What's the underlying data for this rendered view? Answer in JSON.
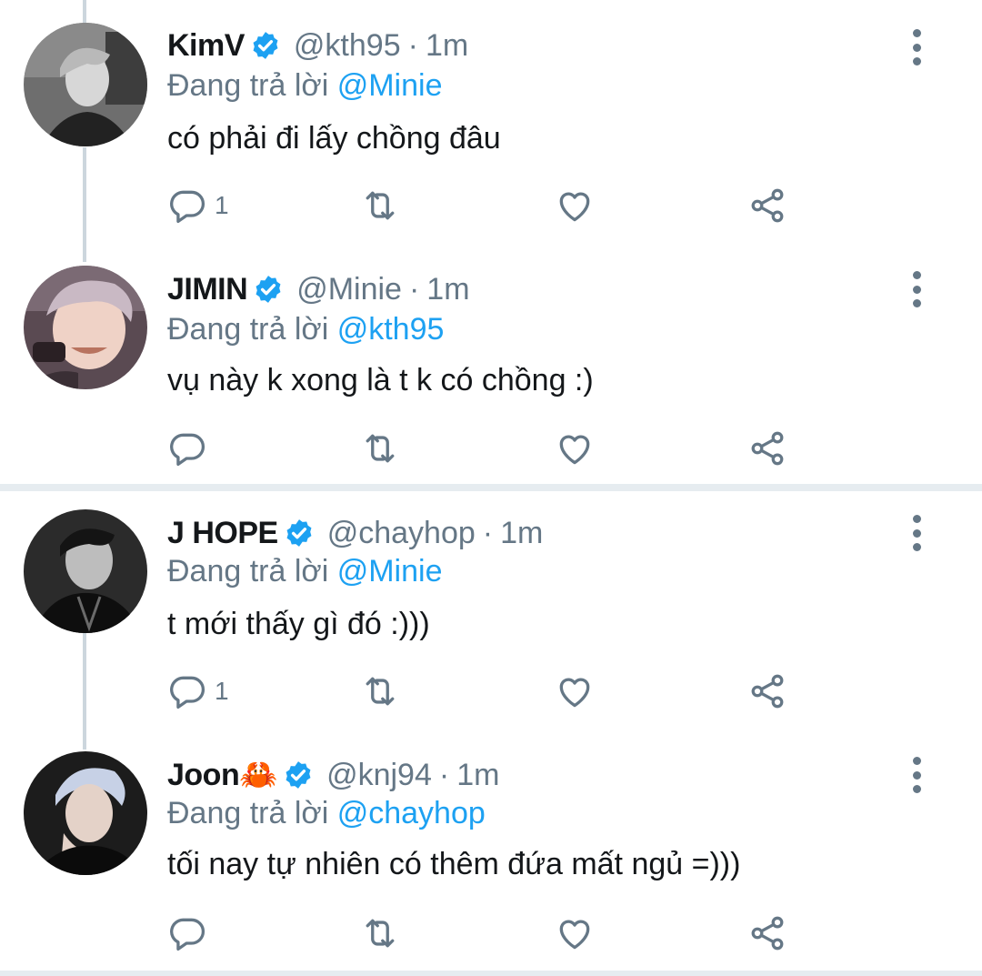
{
  "tweets": [
    {
      "name": "KimV",
      "handle": "@kth95",
      "separator": "·",
      "time": "1m",
      "reply_prefix": "Đang trả lời",
      "reply_to": "@Minie",
      "text": "có phải đi lấy chồng đâu",
      "reply_count": "1"
    },
    {
      "name": "JIMIN",
      "handle": "@Minie",
      "separator": "·",
      "time": "1m",
      "reply_prefix": "Đang trả lời",
      "reply_to": "@kth95",
      "text": "vụ này k xong là t k có chồng :)",
      "reply_count": ""
    },
    {
      "name": "J HOPE",
      "handle": "@chayhop",
      "separator": "·",
      "time": "1m",
      "reply_prefix": "Đang trả lời",
      "reply_to": "@Minie",
      "text": "t mới thấy gì đó :)))",
      "reply_count": "1"
    },
    {
      "name": "Joon🦀",
      "handle": "@knj94",
      "separator": "·",
      "time": "1m",
      "reply_prefix": "Đang trả lời",
      "reply_to": "@chayhop",
      "text": "tối nay tự nhiên có thêm đứa mất ngủ =)))",
      "reply_count": ""
    }
  ],
  "icons": {
    "verified": "verified-badge-icon",
    "more": "more-options-icon",
    "reply": "reply-icon",
    "retweet": "retweet-icon",
    "like": "like-icon",
    "share": "share-icon"
  },
  "colors": {
    "link": "#1da1f2",
    "secondary_text": "#657786",
    "primary_text": "#14171a",
    "thread_line": "#ccd6dd",
    "divider": "#e6ecf0",
    "verified": "#1da1f2"
  }
}
